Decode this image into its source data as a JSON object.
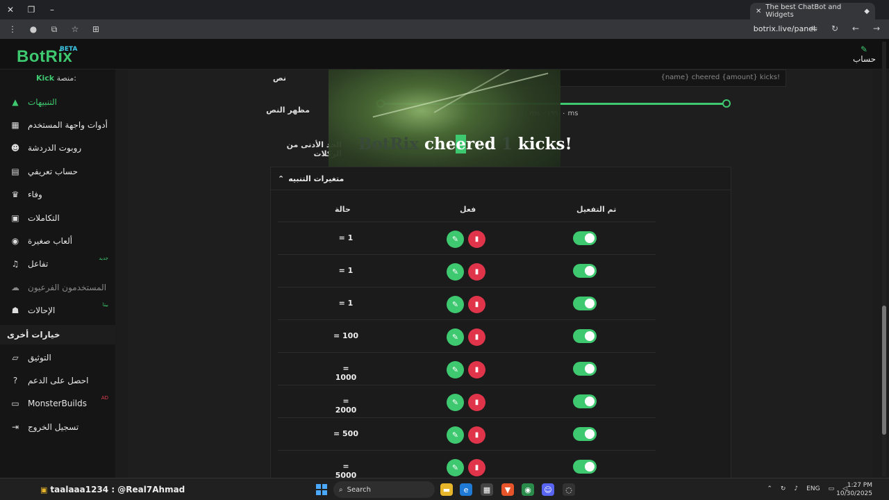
{
  "browser": {
    "tab_title": "The best ChatBot and Widgets",
    "url": "botrix.live/panel"
  },
  "header": {
    "logo": "BotRix",
    "beta": "BETA",
    "account": "حساب"
  },
  "sidebar": {
    "platform_label": "منصة:",
    "platform_name": "Kick",
    "items": [
      {
        "label": "التنبيهات",
        "icon": "warning-icon"
      },
      {
        "label": "أدوات واجهة المستخدم",
        "icon": "layout-icon"
      },
      {
        "label": "روبوت الدردشة",
        "icon": "robot-icon"
      },
      {
        "label": "حساب تعريفي",
        "icon": "id-card-icon"
      },
      {
        "label": "وفاء",
        "icon": "trophy-icon"
      },
      {
        "label": "التكاملات",
        "icon": "integrations-icon"
      },
      {
        "label": "ألعاب صغيرة",
        "icon": "gamepad-icon"
      },
      {
        "label": "تفاعل",
        "icon": "music-icon",
        "tag": "جديد"
      },
      {
        "label": "المستخدمون الفرعيون",
        "icon": "users-icon"
      },
      {
        "label": "الإحالات",
        "icon": "referral-icon",
        "tag": "بيتا"
      }
    ],
    "section_title": "خيارات أخرى",
    "other_items": [
      {
        "label": "التوثيق",
        "icon": "scroll-icon"
      },
      {
        "label": "احصل على الدعم",
        "icon": "question-icon"
      },
      {
        "label": "MonsterBuilds",
        "icon": "laptop-icon",
        "tag": "AD"
      },
      {
        "label": "تسجيل الخروج",
        "icon": "logout-icon"
      }
    ]
  },
  "form": {
    "text_label": "نص",
    "text_value": "{name} cheered {amount} kicks!",
    "text_display_label": "مظهر النص",
    "slider_value": "٠ ms - ١٩٩٠٠ ms",
    "min_kicks_label": "الحد الأدنى من الركلات",
    "min_kicks_value": "1"
  },
  "preview": {
    "faint_part": "BotRix",
    "word1": "che",
    "highlight": "e",
    "word1_rest": "red",
    "amount": "1",
    "word2": "kicks!"
  },
  "variations": {
    "title": "متغيرات التنبيه",
    "columns": {
      "status": "حالة",
      "action": "فعل",
      "enabled": "تم التفعيل"
    },
    "rows": [
      {
        "condition": "= 1",
        "enabled": true
      },
      {
        "condition": "= 1",
        "enabled": true
      },
      {
        "condition": "= 1",
        "enabled": true
      },
      {
        "condition": "= 100",
        "enabled": true
      },
      {
        "condition": "= 1000",
        "enabled": true
      },
      {
        "condition": "= 2000",
        "enabled": true
      },
      {
        "condition": "= 500",
        "enabled": true
      },
      {
        "condition": "= 5000",
        "enabled": true
      }
    ]
  },
  "taskbar": {
    "stream_text": "taalaaa1234 : @Real7Ahmad",
    "search_placeholder": "Search",
    "lang": "ENG",
    "time": "1:27 PM",
    "date": "10/30/2025"
  },
  "colors": {
    "accent": "#3ec86f",
    "danger": "#e0344a",
    "background": "#1c1c1c"
  }
}
